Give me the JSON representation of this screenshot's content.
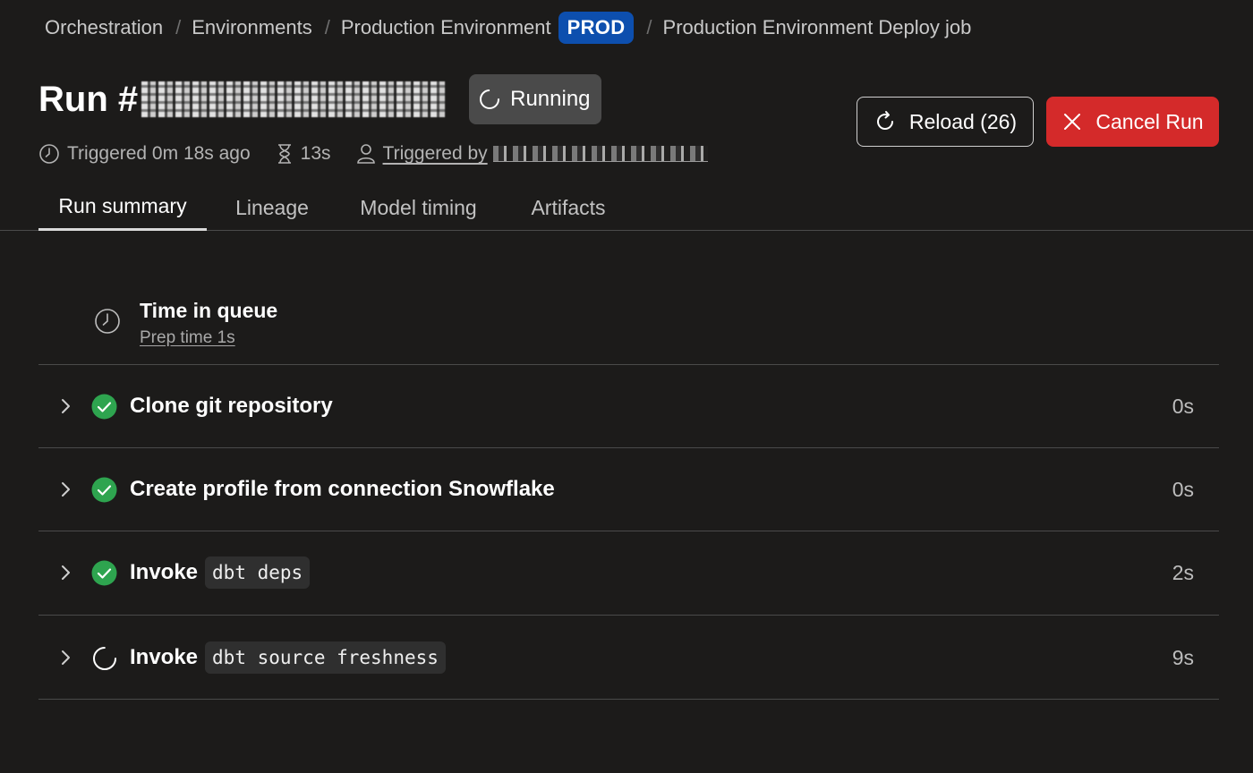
{
  "breadcrumb": {
    "items": [
      "Orchestration",
      "Environments",
      "Production Environment",
      "Production Environment Deploy job"
    ],
    "separator": "/",
    "env_badge": "PROD"
  },
  "run": {
    "title_prefix": "Run #",
    "status": "Running"
  },
  "meta": {
    "triggered_ago": "Triggered 0m 18s ago",
    "duration": "13s",
    "triggered_by_label": "Triggered by"
  },
  "actions": {
    "reload_label": "Reload (26)",
    "cancel_label": "Cancel Run"
  },
  "tabs": [
    {
      "label": "Run summary",
      "active": true
    },
    {
      "label": "Lineage",
      "active": false
    },
    {
      "label": "Model timing",
      "active": false
    },
    {
      "label": "Artifacts",
      "active": false
    }
  ],
  "queue": {
    "title": "Time in queue",
    "subtitle": "Prep time 1s"
  },
  "steps": [
    {
      "prefix": "Clone git repository",
      "code": "",
      "status": "success",
      "duration": "0s"
    },
    {
      "prefix": "Create profile from connection Snowflake",
      "code": "",
      "status": "success",
      "duration": "0s"
    },
    {
      "prefix": "Invoke",
      "code": "dbt deps",
      "status": "success",
      "duration": "2s"
    },
    {
      "prefix": "Invoke",
      "code": "dbt source freshness",
      "status": "running",
      "duration": "9s"
    }
  ],
  "colors": {
    "background": "#1c1b1a",
    "success": "#2ea44f",
    "cancel": "#d42a2a",
    "env_badge": "#0d4fae",
    "status_pill": "#4a4a4a"
  }
}
